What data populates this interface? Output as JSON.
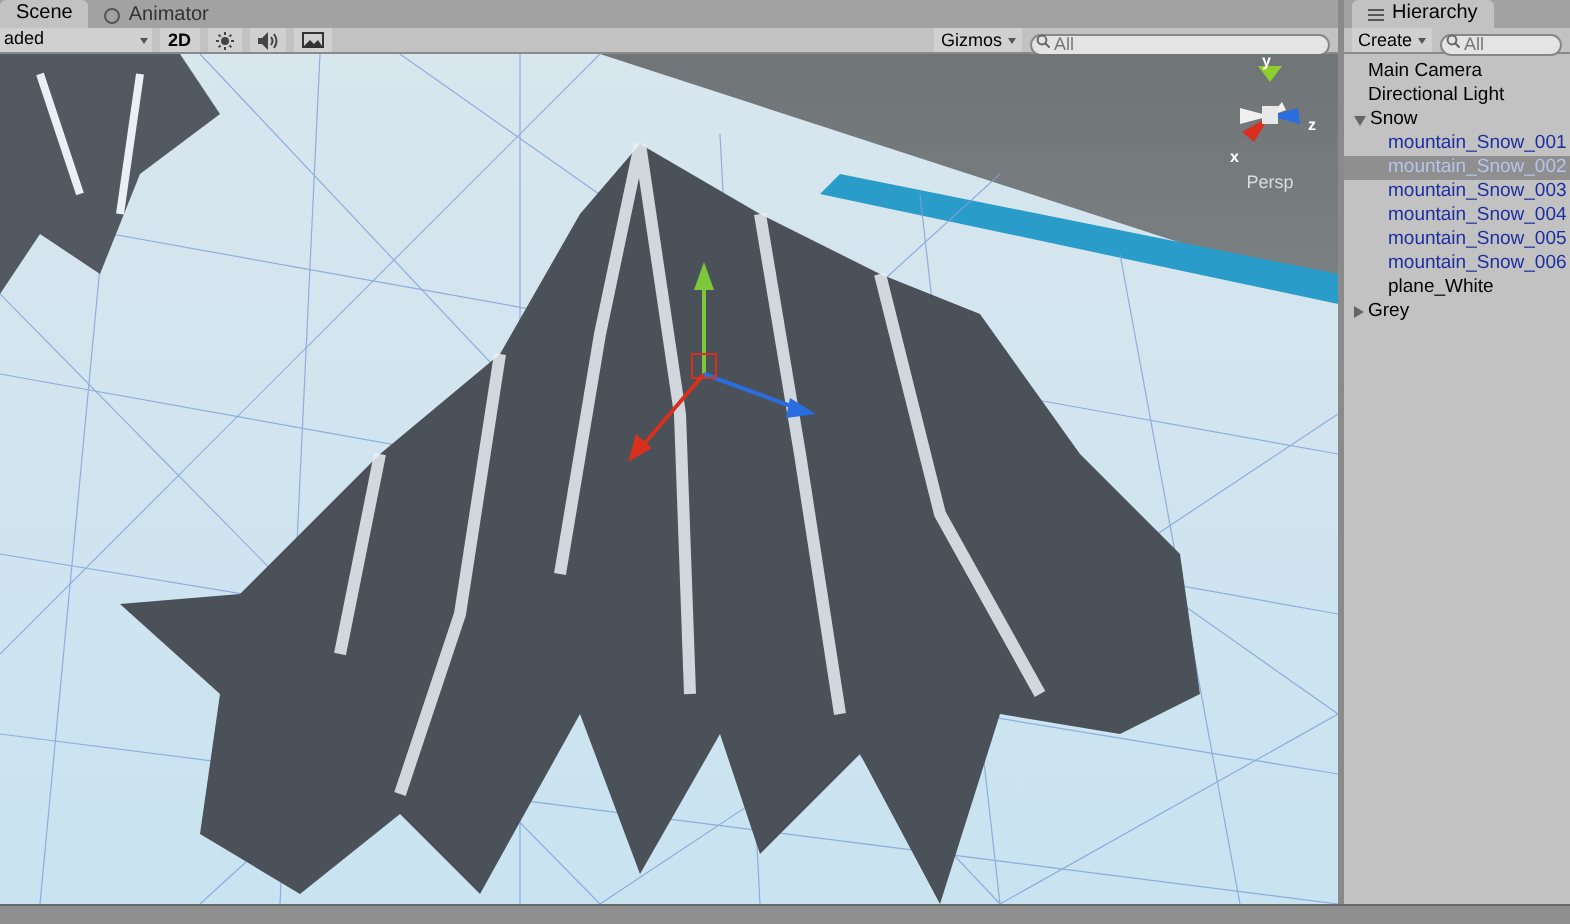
{
  "scene_tabs": [
    {
      "label": "Scene",
      "selected": true
    },
    {
      "label": "Animator",
      "selected": false
    }
  ],
  "scene_toolbar": {
    "draw_mode": "aded",
    "mode_2d": "2D",
    "toggles": [
      {
        "kind": "lighting",
        "on": false
      },
      {
        "kind": "audio",
        "on": false
      },
      {
        "kind": "effects",
        "on": false
      }
    ],
    "gizmos": "Gizmos",
    "search": {
      "placeholder": "All"
    }
  },
  "scene_view": {
    "axis_labels": [
      "y",
      "x",
      "z"
    ],
    "projection": "Persp"
  },
  "hierarchy": {
    "tab": "Hierarchy",
    "create": "Create",
    "search": {
      "placeholder": "All"
    },
    "items": [
      {
        "label": "Main Camera",
        "kind": "object",
        "selected": false
      },
      {
        "label": "Directional Light",
        "kind": "object",
        "selected": false
      },
      {
        "label": "Snow",
        "kind": "group",
        "expanded": true,
        "selected": false,
        "children": [
          {
            "label": "mountain_Snow_001",
            "kind": "prefab",
            "selected": false
          },
          {
            "label": "mountain_Snow_002",
            "kind": "prefab",
            "selected": true
          },
          {
            "label": "mountain_Snow_003",
            "kind": "prefab",
            "selected": false
          },
          {
            "label": "mountain_Snow_004",
            "kind": "prefab",
            "selected": false
          },
          {
            "label": "mountain_Snow_005",
            "kind": "prefab",
            "selected": false
          },
          {
            "label": "mountain_Snow_006",
            "kind": "prefab",
            "selected": false
          },
          {
            "label": "plane_White",
            "kind": "object",
            "selected": false
          }
        ]
      },
      {
        "label": "Grey",
        "kind": "group",
        "expanded": false,
        "selected": false
      }
    ]
  }
}
